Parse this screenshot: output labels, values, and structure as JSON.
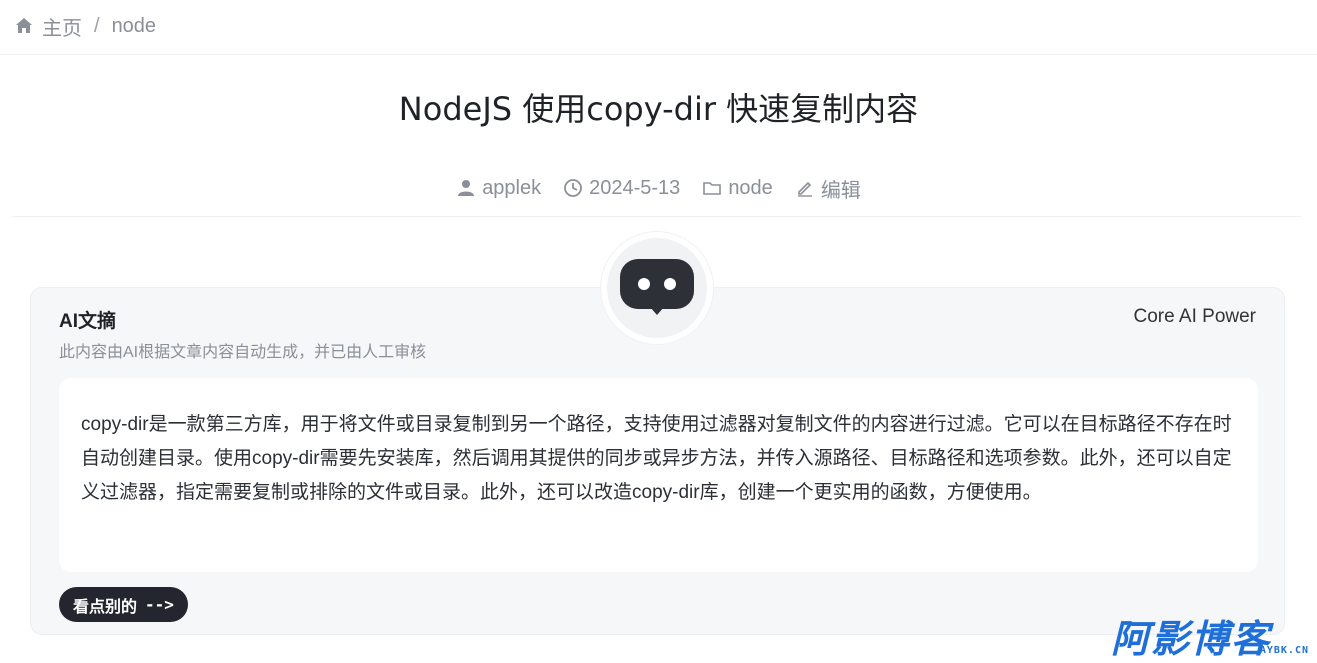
{
  "breadcrumb": {
    "home_label": "主页",
    "separator": "/",
    "current": "node"
  },
  "article": {
    "title": "NodeJS 使用copy-dir 快速复制内容",
    "meta": {
      "author": "applek",
      "date": "2024-5-13",
      "category": "node",
      "edit_label": "编辑"
    }
  },
  "ai_card": {
    "title": "AI文摘",
    "subtitle": "此内容由AI根据文章内容自动生成，并已由人工审核",
    "power_label": "Core AI Power",
    "summary": "copy-dir是一款第三方库，用于将文件或目录复制到另一个路径，支持使用过滤器对复制文件的内容进行过滤。它可以在目标路径不存在时自动创建目录。使用copy-dir需要先安装库，然后调用其提供的同步或异步方法，并传入源路径、目标路径和选项参数。此外，还可以自定义过滤器，指定需要复制或排除的文件或目录。此外，还可以改造copy-dir库，创建一个更实用的函数，方便使用。",
    "more_label": "看点别的",
    "more_arrow": "-->"
  },
  "watermark": {
    "text": "阿影博客",
    "domain": "AYBK.CN"
  },
  "colors": {
    "accent": "#1e6fd9",
    "button_bg": "#23262f",
    "card_bg": "#f6f7f9",
    "muted": "#8a8f99"
  }
}
